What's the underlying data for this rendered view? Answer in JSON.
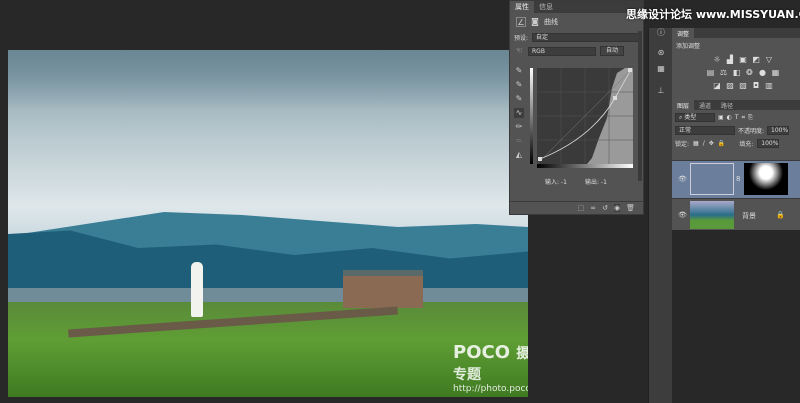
{
  "watermarks": {
    "top": "思缘设计论坛 www.MISSYUAN.COM",
    "bottom_logo": "POCO",
    "bottom_title": "摄影专题",
    "bottom_url": "http://photo.poco.cn/"
  },
  "properties": {
    "tabs": [
      "属性",
      "信息"
    ],
    "type_label": "曲线",
    "preset_label": "预设:",
    "preset_value": "自定",
    "channel_value": "RGB",
    "auto_label": "自动",
    "input_label": "输入: -1",
    "output_label": "输出: -1"
  },
  "adjustments": {
    "tab": "调整",
    "title": "添加调整"
  },
  "layers": {
    "tabs": [
      "图层",
      "通道",
      "路径"
    ],
    "filter_value": "类型",
    "blend_mode": "正常",
    "opacity_label": "不透明度:",
    "opacity_value": "100%",
    "lock_label": "锁定:",
    "fill_label": "填充:",
    "fill_value": "100%",
    "items": [
      {
        "name": ""
      },
      {
        "name": "背景"
      }
    ]
  }
}
